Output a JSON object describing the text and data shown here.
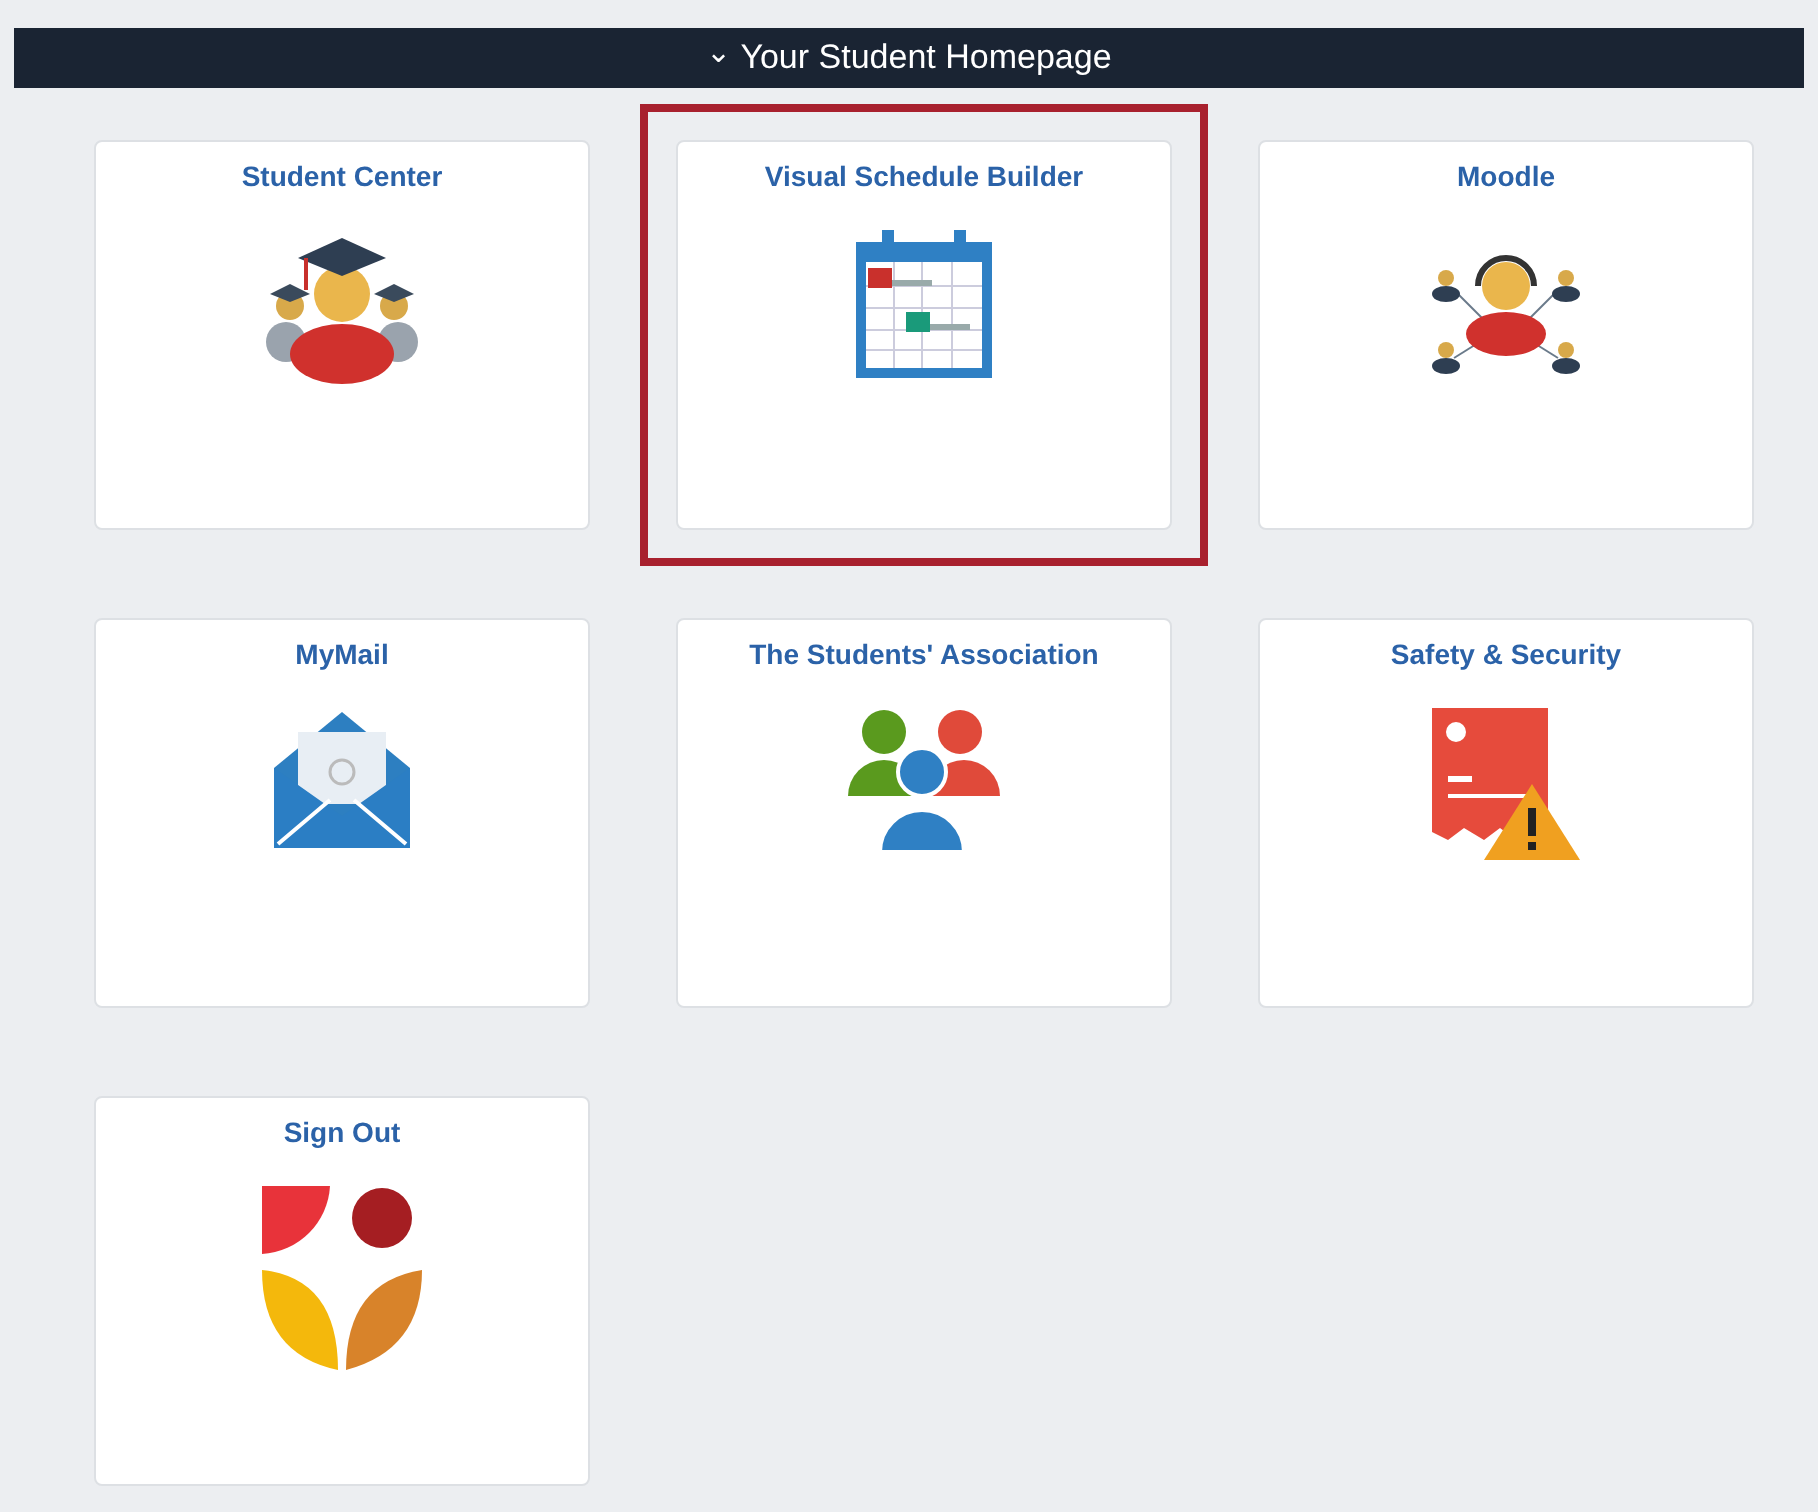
{
  "header": {
    "chevron": "⌄",
    "title": "Your Student Homepage"
  },
  "tiles": [
    {
      "title": "Student Center",
      "kind": "graduate",
      "highlighted": false
    },
    {
      "title": "Visual Schedule Builder",
      "kind": "calendar",
      "highlighted": true
    },
    {
      "title": "Moodle",
      "kind": "network",
      "highlighted": false
    },
    {
      "title": "MyMail",
      "kind": "mail",
      "highlighted": false
    },
    {
      "title": "The Students' Association",
      "kind": "group",
      "highlighted": false
    },
    {
      "title": "Safety & Security",
      "kind": "warning",
      "highlighted": false
    },
    {
      "title": "Sign Out",
      "kind": "logo",
      "highlighted": false
    }
  ]
}
